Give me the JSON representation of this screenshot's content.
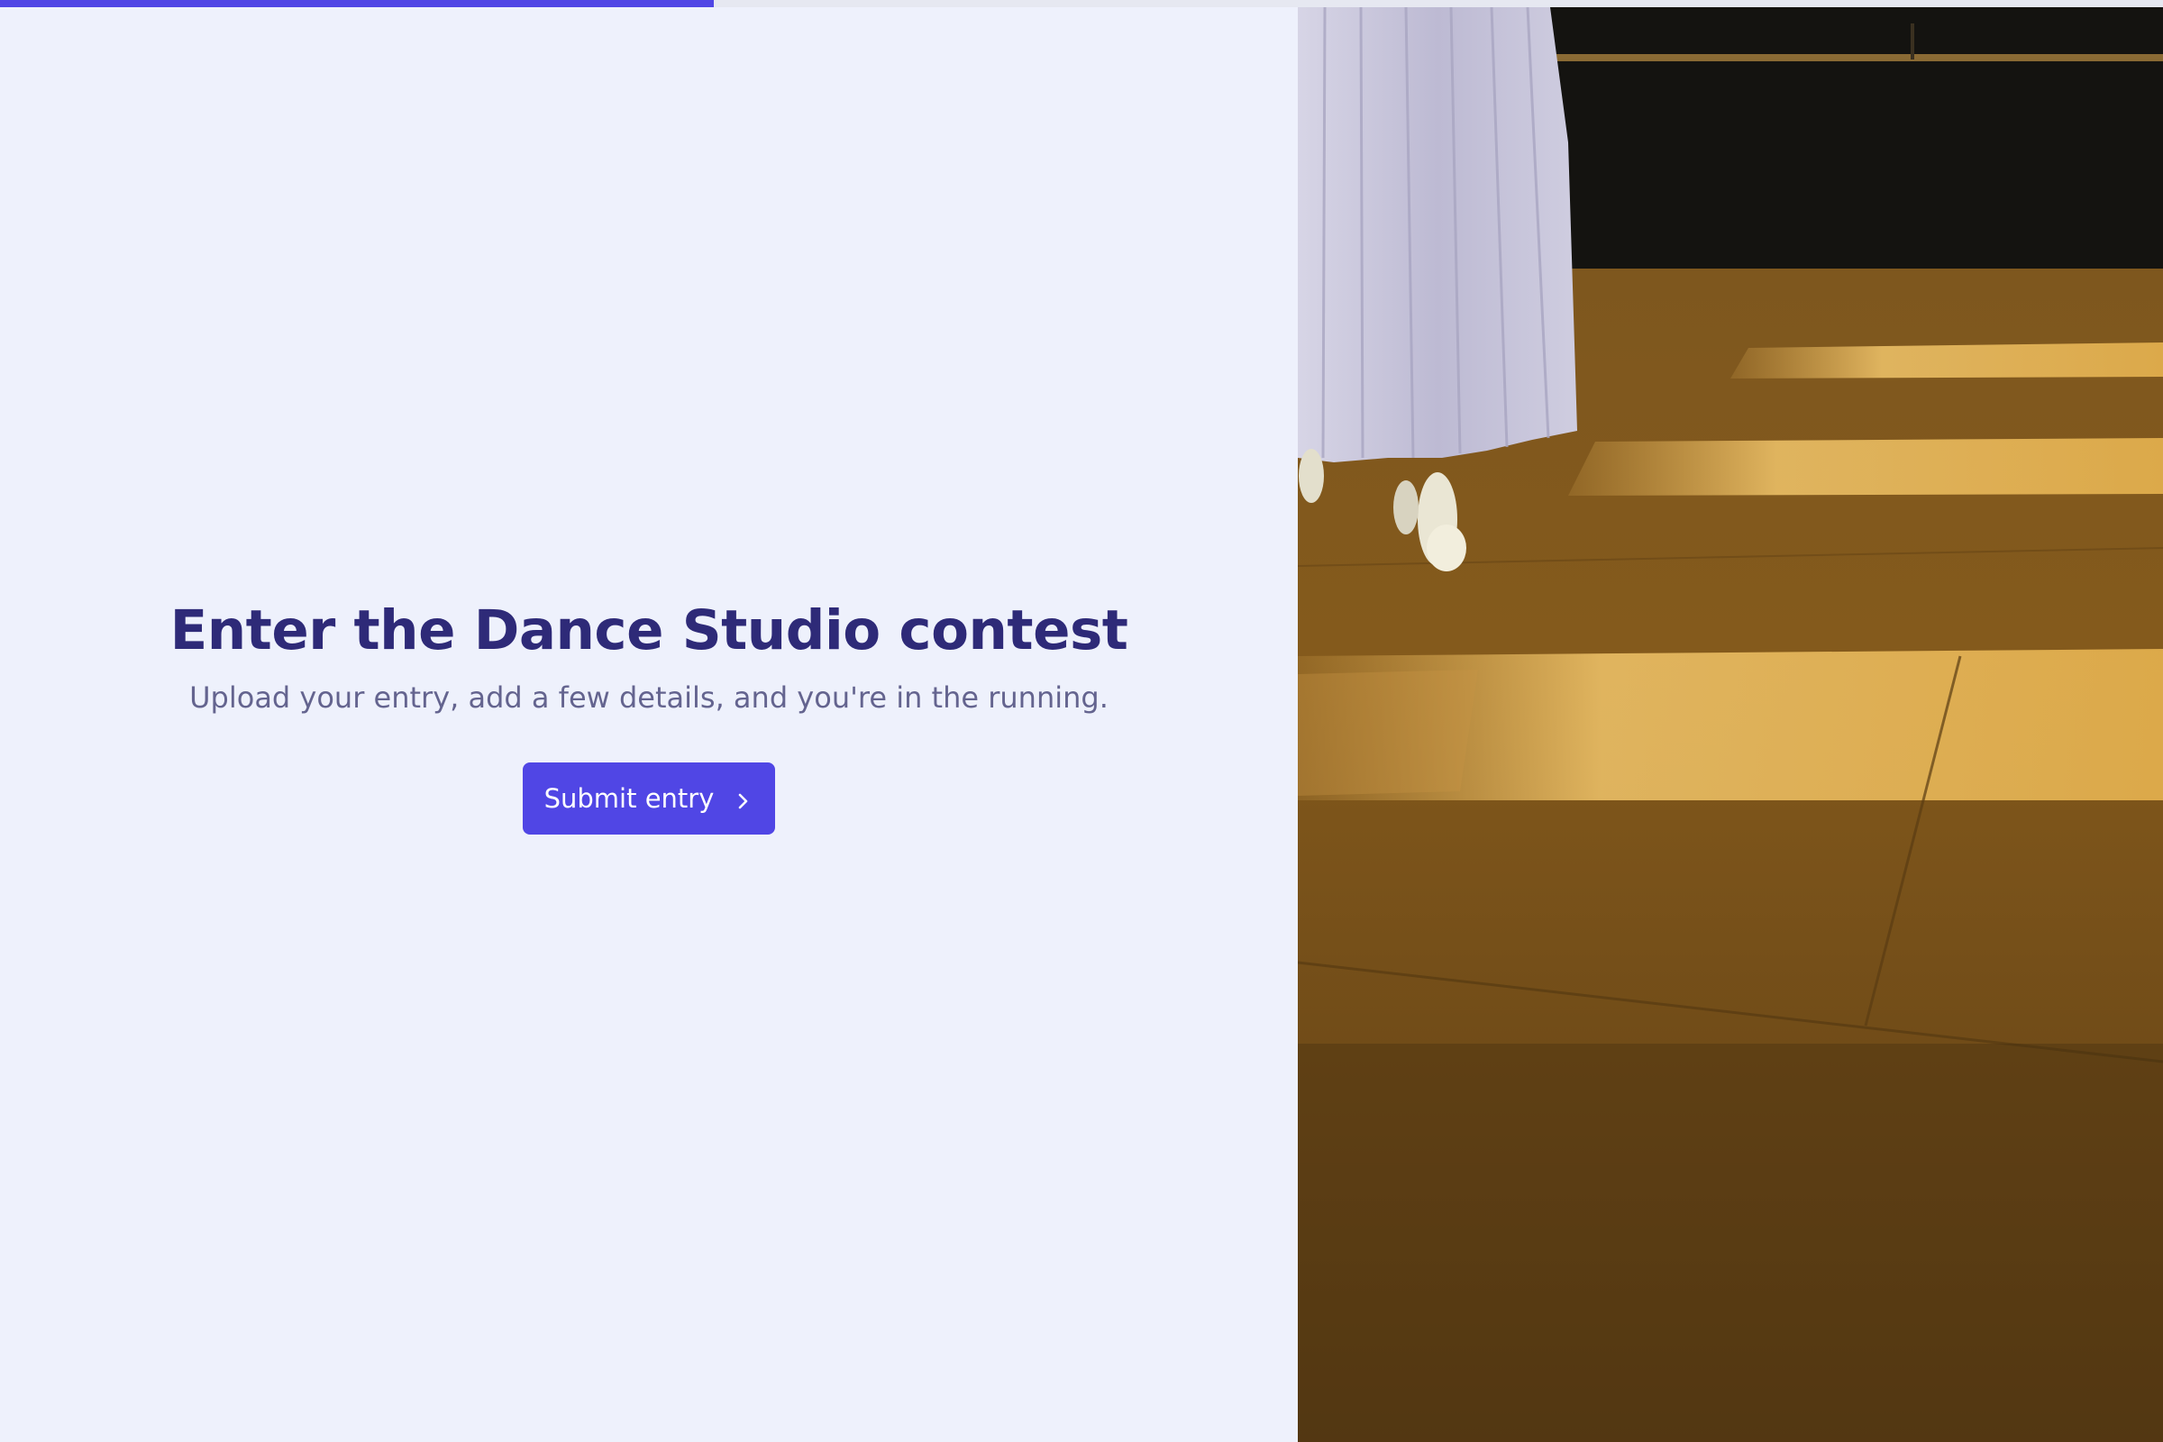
{
  "progress": {
    "value_percent": 33
  },
  "hero": {
    "title": "Enter the Dance Studio contest",
    "subtitle": "Upload your entry, add a few details, and you're in the running.",
    "button_label": "Submit entry",
    "button_icon": "chevron-right-icon"
  },
  "colors": {
    "accent": "#5046e5",
    "title": "#2e2a78",
    "subtitle": "#64648f",
    "background": "#eef1fc"
  },
  "photo": {
    "subject": "ballet-dancer-photo"
  }
}
